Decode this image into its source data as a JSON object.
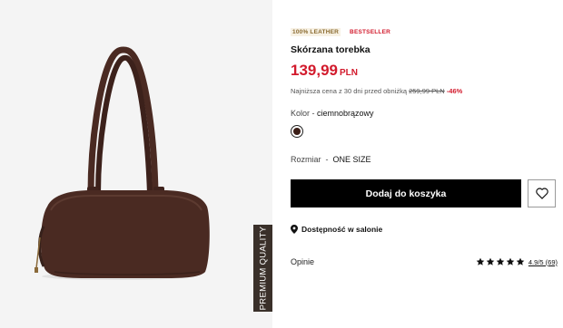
{
  "image": {
    "premium_tag": "PREMIUM QUALITY"
  },
  "product": {
    "badges": [
      "100% LEATHER",
      "BESTSELLER"
    ],
    "name": "Skórzana torebka",
    "price": {
      "amount": "139,99",
      "currency": "PLN"
    },
    "lowest_price": {
      "text": "Najniższa cena z 30 dni przed obniżką",
      "old_price": "259,99 PLN",
      "discount": "-46%"
    },
    "color": {
      "label": "Kolor",
      "separator": " - ",
      "value": "ciemnobrązowy",
      "swatch": "#3b1e17"
    },
    "size": {
      "label": "Rozmiar",
      "separator": "  -  ",
      "value": "ONE SIZE"
    },
    "add_to_cart_label": "Dodaj do koszyka",
    "favorite_icon": "heart-icon",
    "availability_icon": "map-pin-icon",
    "availability_label": "Dostępność w salonie",
    "reviews": {
      "label": "Opinie",
      "stars": 5,
      "rating_text": "4.9/5 (69)"
    }
  },
  "colors": {
    "accent": "#d21a2c",
    "button": "#000000",
    "bag": "#4a2a22"
  }
}
